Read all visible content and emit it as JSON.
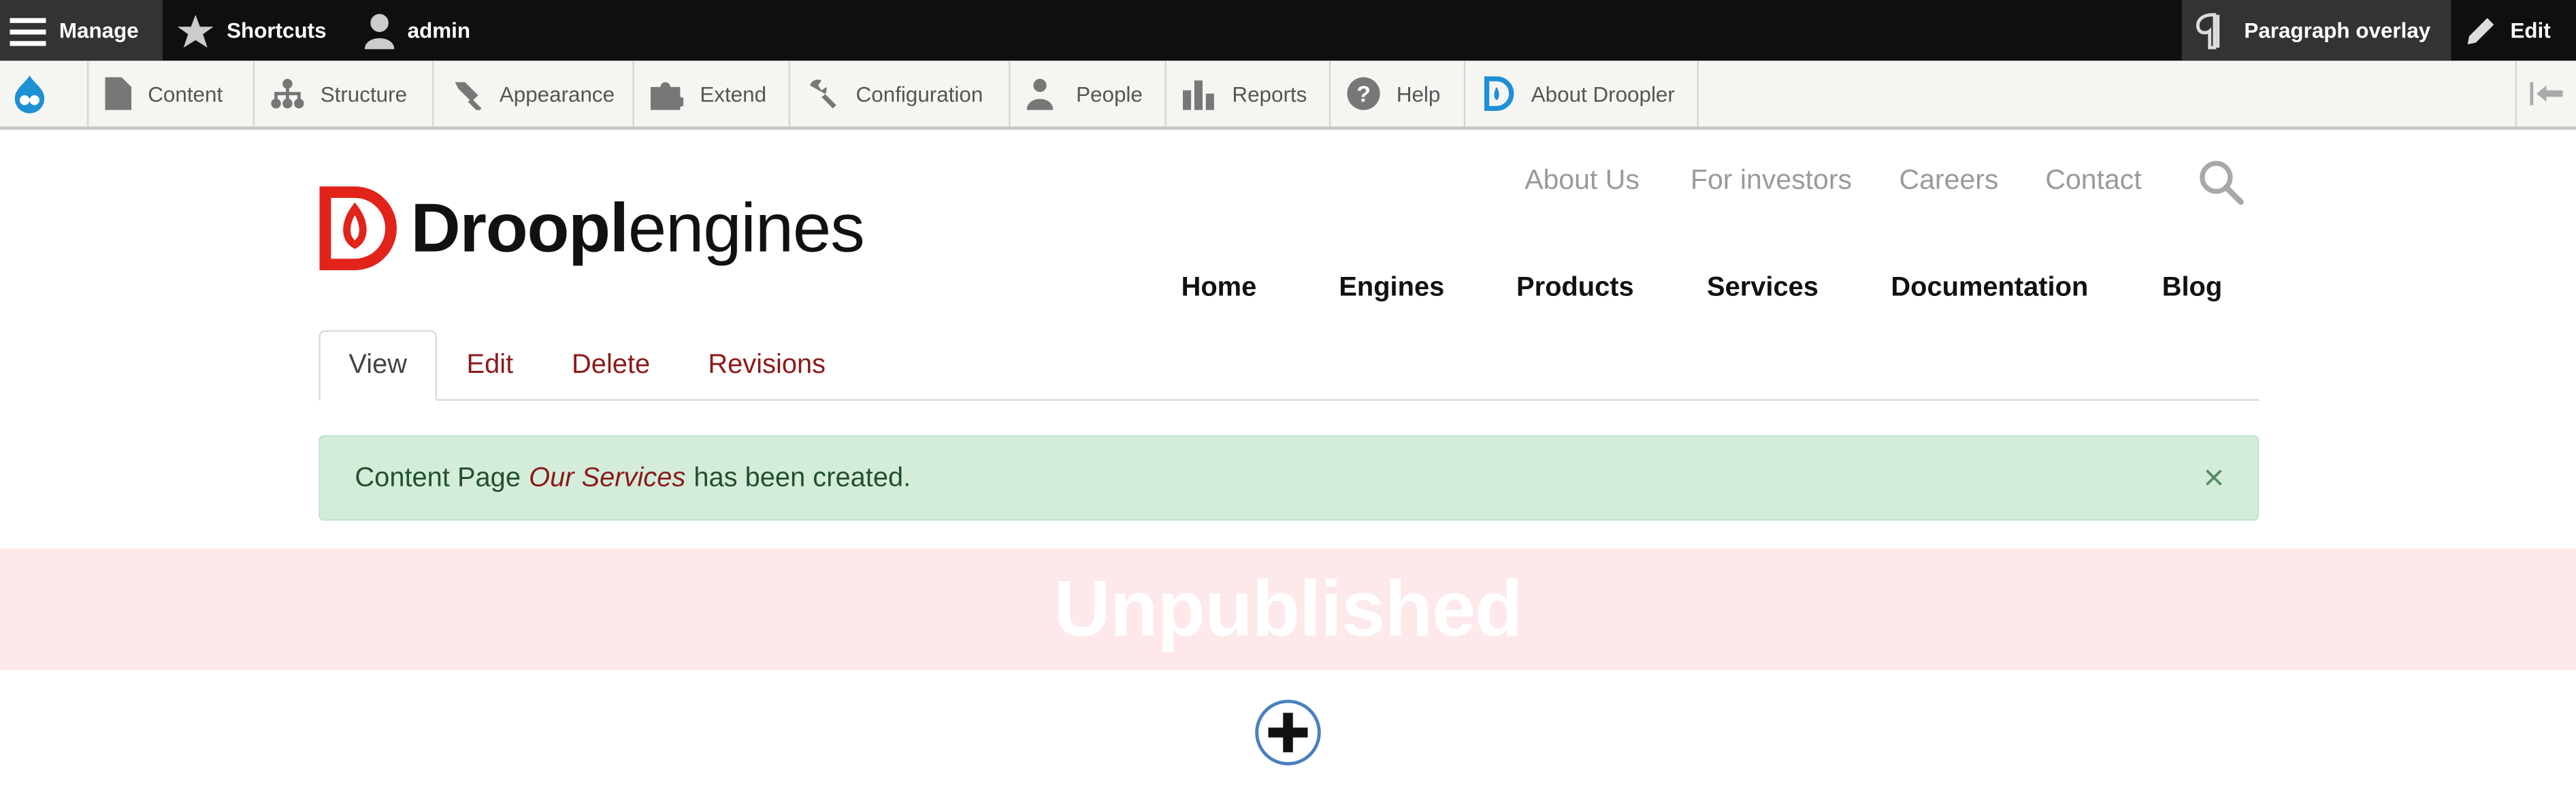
{
  "toolbar": {
    "manage": "Manage",
    "shortcuts": "Shortcuts",
    "user": "admin",
    "paragraph_overlay": "Paragraph overlay",
    "edit": "Edit"
  },
  "admin_menu": {
    "items": [
      {
        "label": "Content",
        "icon": "file-icon"
      },
      {
        "label": "Structure",
        "icon": "structure-icon"
      },
      {
        "label": "Appearance",
        "icon": "brush-icon"
      },
      {
        "label": "Extend",
        "icon": "puzzle-icon"
      },
      {
        "label": "Configuration",
        "icon": "wrench-icon"
      },
      {
        "label": "People",
        "icon": "people-icon"
      },
      {
        "label": "Reports",
        "icon": "bar-chart-icon"
      },
      {
        "label": "Help",
        "icon": "help-icon"
      },
      {
        "label": "About Droopler",
        "icon": "droopler-icon"
      }
    ]
  },
  "site": {
    "logo_bold": "Droopl",
    "logo_light": "engines",
    "secondary_nav": [
      "About Us",
      "For investors",
      "Careers",
      "Contact"
    ],
    "main_nav": [
      "Home",
      "Engines",
      "Products",
      "Services",
      "Documentation",
      "Blog"
    ]
  },
  "tabs": [
    "View",
    "Edit",
    "Delete",
    "Revisions"
  ],
  "message": {
    "prefix": "Content Page",
    "title": "Our Services",
    "suffix": "has been created.",
    "close": "×"
  },
  "status_banner": "Unpublished",
  "colors": {
    "toolbar_bg": "#0f0f0f",
    "brand_red": "#e2231a",
    "link_red": "#8b1a1a",
    "message_bg": "#d4eddb",
    "unpublished_bg": "#fde8ea",
    "add_button_border": "#4a7fc1"
  }
}
